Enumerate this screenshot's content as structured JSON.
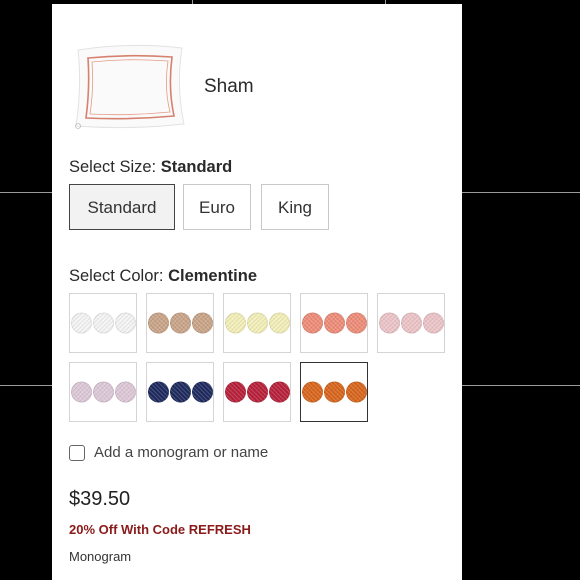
{
  "product": {
    "name": "Sham",
    "image_icon": "pillow-sham-image"
  },
  "size": {
    "label_prefix": "Select Size:",
    "selected": "Standard",
    "options": [
      "Standard",
      "Euro",
      "King"
    ]
  },
  "color": {
    "label_prefix": "Select Color:",
    "selected": "Clementine",
    "swatches": [
      {
        "color": "#f4f4f4"
      },
      {
        "color": "#c9a488"
      },
      {
        "color": "#f3efb8"
      },
      {
        "color": "#ee8c78"
      },
      {
        "color": "#ecc4c8"
      },
      {
        "color": "#ddc8d8"
      },
      {
        "color": "#1e2a5e"
      },
      {
        "color": "#b8203a"
      },
      {
        "color": "#d8651c"
      }
    ]
  },
  "monogram": {
    "checkbox_label": "Add a monogram or name",
    "checked": false
  },
  "pricing": {
    "price": "$39.50",
    "promo": "20% Off With Code REFRESH",
    "sub_label": "Monogram"
  },
  "colors": {
    "promo": "#8b1a1a",
    "selected_border": "#333333",
    "background": "#000000"
  }
}
